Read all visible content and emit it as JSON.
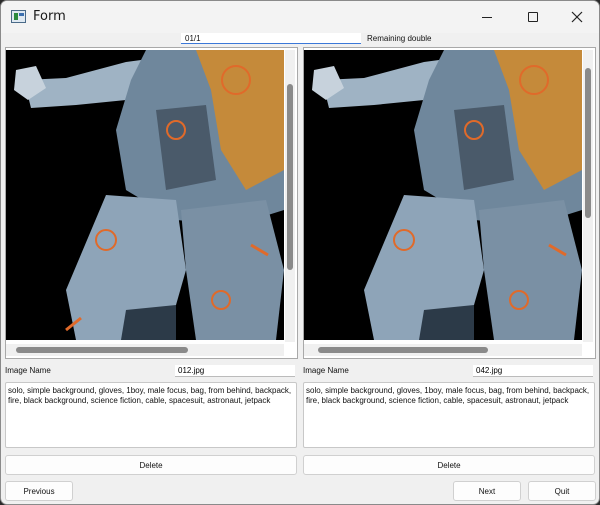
{
  "window": {
    "title": "Form"
  },
  "header": {
    "counter": "01/1",
    "remaining": "Remaining double"
  },
  "left": {
    "image_name_label": "Image Name",
    "image_name": "012.jpg",
    "tags": "solo, simple background, gloves, 1boy, male focus, bag, from behind, backpack, fire, black background, science fiction, cable, spacesuit, astronaut, jetpack",
    "delete_label": "Delete",
    "image_icon": "astronaut-photo"
  },
  "right": {
    "image_name_label": "Image Name",
    "image_name": "042.jpg",
    "tags": "solo, simple background, gloves, 1boy, male focus, bag, from behind, backpack, fire, black background, science fiction, cable, spacesuit, astronaut, jetpack",
    "delete_label": "Delete",
    "image_icon": "astronaut-photo"
  },
  "footer": {
    "previous_label": "Previous",
    "next_label": "Next",
    "quit_label": "Quit"
  }
}
